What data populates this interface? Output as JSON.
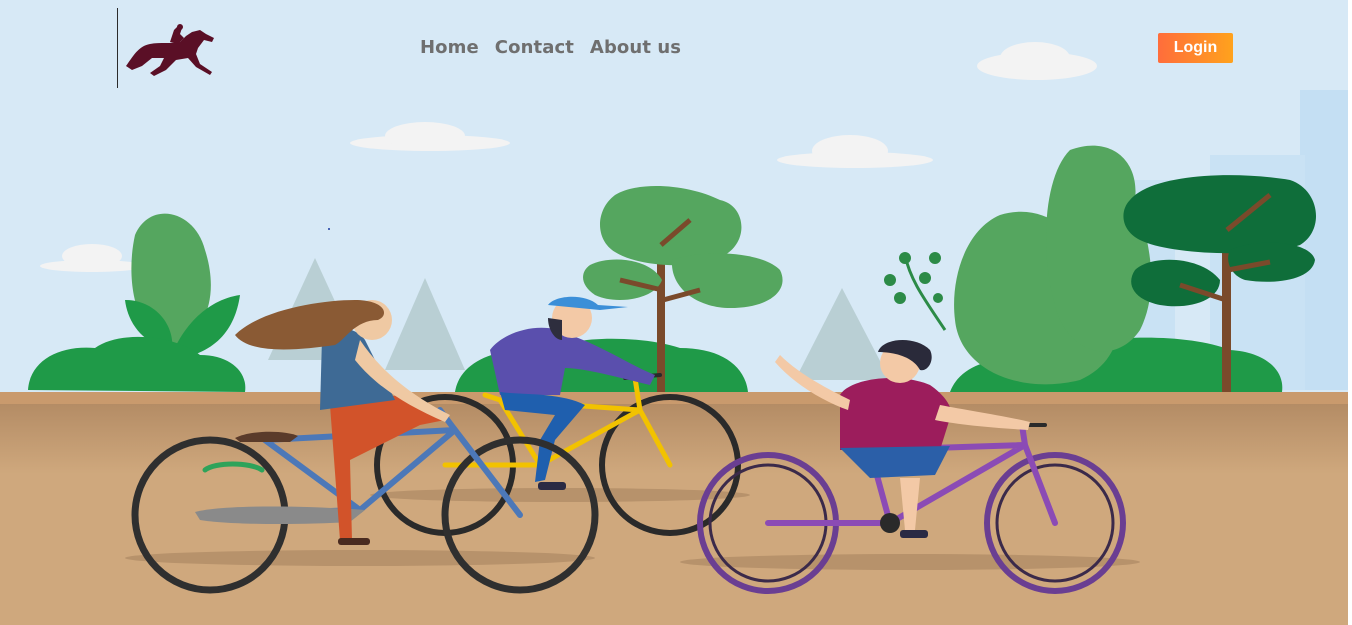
{
  "navbar": {
    "logo_icon": "horse-rider-icon",
    "links": [
      {
        "label": "Home"
      },
      {
        "label": "Contact"
      },
      {
        "label": "About us"
      }
    ],
    "login_label": "Login"
  },
  "hero": {
    "illustration": "kids-cycling-in-park",
    "colors": {
      "sky": "#d7e9f6",
      "ground": "#cfa87d",
      "trees_light": "#55a65f",
      "trees_dark": "#0f7a3d",
      "login_gradient_start": "#ff6d3b",
      "login_gradient_end": "#ffa21d"
    }
  }
}
